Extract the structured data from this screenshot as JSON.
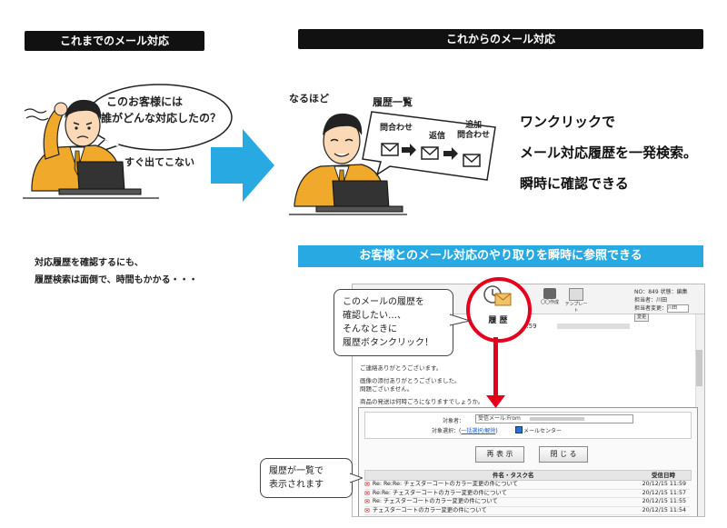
{
  "left": {
    "header": "これまでのメール対応",
    "speech": [
      "このお客様には",
      "誰がどんな対応したの？"
    ],
    "aside": "すぐ出てこない",
    "caption": [
      "対応履歴を確認するにも、",
      "履歴検索は面倒で、時間もかかる・・・"
    ]
  },
  "right": {
    "header": "これからのメール対応",
    "reaction": "なるほど",
    "board_title": "履歴一覧",
    "flow": [
      "問合わせ",
      "返信",
      "追加\n問合わせ"
    ],
    "headline": [
      "ワンクリックで",
      "メール対応履歴を一発検索。",
      "瞬時に確認できる"
    ],
    "bar": "お客様とのメール対応のやり取りを瞬時に参照できる"
  },
  "screen": {
    "meta": [
      "NO：849  状態：編集",
      "担当者：川田",
      "担当者変更：",
      "変更"
    ],
    "assignee_select": "川田",
    "history_label": "履 歴",
    "toolbar_labels": [
      "〇〇作成",
      "テンプレート"
    ],
    "date_line": "12/15 11:59",
    "body": [
      "ご連絡ありがとうございます。",
      "画像の添付ありがとうございました。",
      "問題ございません。",
      "商品の発送は何時ごろになりますでしょうか。"
    ],
    "panel": {
      "target_label": "対象者：",
      "target_value": "受信メール:From",
      "filter_label": "対象選択：(",
      "filter_link": "一括選択/解除",
      "filter_end": ")",
      "mail_center": "メールセンター",
      "show_button": "再 表 示",
      "close_button": "閉 じ る",
      "col_subject": "件名・タスク名",
      "col_date": "受信日時",
      "rows": [
        {
          "subject": "Re: Re:Re: チェスターコートのカラー変更の件について",
          "date": "20/12/15 11:59"
        },
        {
          "subject": "Re:Re: チェスターコートのカラー変更の件について",
          "date": "20/12/15 11:57"
        },
        {
          "subject": "Re: チェスターコートのカラー変更の件について",
          "date": "20/12/15 11:55"
        },
        {
          "subject": "チェスターコートのカラー変更の件について",
          "date": "20/12/15 11:54"
        }
      ]
    },
    "callout_top": [
      "このメールの履歴を",
      "確認したい…、",
      "そんなときに",
      "履歴ボタンクリック！"
    ],
    "callout_bottom": [
      "履歴が一覧で",
      "表示されます"
    ]
  },
  "colors": {
    "accent_blue": "#29a9e1",
    "red": "#e5001b",
    "suit": "#f0a92b"
  }
}
